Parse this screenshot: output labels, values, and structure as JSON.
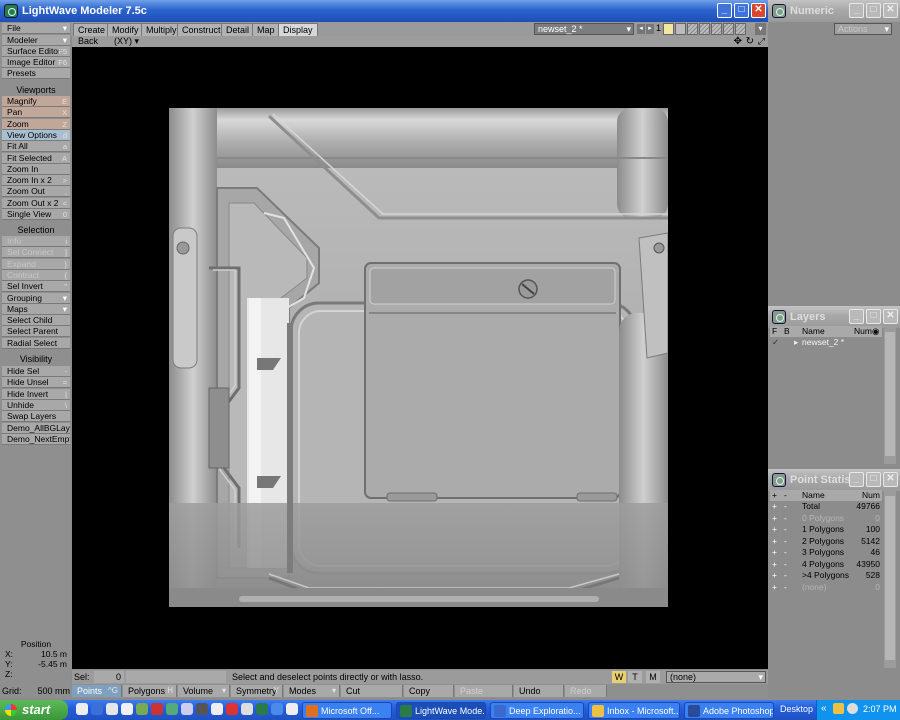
{
  "window": {
    "title": "LightWave Modeler 7.5c",
    "tabs": [
      "Create",
      "Modify",
      "Multiply",
      "Construct",
      "Detail",
      "Map",
      "Display"
    ],
    "active_tab": "Display",
    "object_select": "newset_2 *",
    "layer_number": "1"
  },
  "left_menu": {
    "file": "File",
    "modeler": "Modeler",
    "items_top": [
      {
        "label": "Surface Editor",
        "shortcut": "F5"
      },
      {
        "label": "Image Editor",
        "shortcut": "F6"
      },
      {
        "label": "Presets",
        "shortcut": ""
      }
    ]
  },
  "toolbar": {
    "viewports_header": "Viewports",
    "viewports": [
      {
        "label": "Magnify",
        "shortcut": "E"
      },
      {
        "label": "Pan",
        "shortcut": "X"
      },
      {
        "label": "Zoom",
        "shortcut": "Z"
      },
      {
        "label": "View Options",
        "shortcut": "d"
      },
      {
        "label": "Fit All",
        "shortcut": "a"
      },
      {
        "label": "Fit Selected",
        "shortcut": "A"
      },
      {
        "label": "Zoom In",
        "shortcut": "."
      },
      {
        "label": "Zoom In x 2",
        "shortcut": ">"
      },
      {
        "label": "Zoom Out",
        "shortcut": ","
      },
      {
        "label": "Zoom Out x 2",
        "shortcut": "<"
      },
      {
        "label": "Single View",
        "shortcut": "0"
      }
    ],
    "selection_header": "Selection",
    "selection": [
      {
        "label": "Info",
        "shortcut": "i"
      },
      {
        "label": "Sel Connect",
        "shortcut": "]"
      },
      {
        "label": "Expand",
        "shortcut": "}"
      },
      {
        "label": "Contract",
        "shortcut": "{"
      },
      {
        "label": "Sel Invert",
        "shortcut": "\""
      },
      {
        "label": "Grouping",
        "shortcut": ""
      },
      {
        "label": "Maps",
        "shortcut": ""
      },
      {
        "label": "Select Child",
        "shortcut": ""
      },
      {
        "label": "Select Parent",
        "shortcut": ""
      },
      {
        "label": "Radial Select",
        "shortcut": ""
      }
    ],
    "visibility_header": "Visibility",
    "visibility": [
      {
        "label": "Hide Sel",
        "shortcut": "-"
      },
      {
        "label": "Hide Unsel",
        "shortcut": "="
      },
      {
        "label": "Hide Invert",
        "shortcut": "|"
      },
      {
        "label": "Unhide",
        "shortcut": "\\"
      },
      {
        "label": "Swap Layers",
        "shortcut": ""
      },
      {
        "label": "Demo_AllBGLay",
        "shortcut": ""
      },
      {
        "label": "Demo_NextEmpt",
        "shortcut": ""
      }
    ]
  },
  "viewport": {
    "back_label": "Back",
    "view_label": "(XY)"
  },
  "position": {
    "header": "Position",
    "x_label": "X:",
    "x_value": "10.5 m",
    "y_label": "Y:",
    "y_value": "-5.45 m",
    "z_label": "Z:",
    "z_value": "",
    "grid_label": "Grid:",
    "grid_value": "500 mm"
  },
  "status": {
    "sel_label": "Sel:",
    "sel_value": "0",
    "message": "Select and deselect points directly or with lasso.",
    "w": "W",
    "t": "T",
    "m": "M",
    "surface": "(none)"
  },
  "bottom_bar": [
    {
      "label": "Points",
      "shortcut": "^G",
      "state": "on"
    },
    {
      "label": "Polygons",
      "shortcut": "H",
      "state": "normal"
    },
    {
      "label": "Volume",
      "shortcut": "",
      "state": "menu"
    },
    {
      "label": "Symmetry",
      "shortcut": "Y",
      "state": "normal"
    },
    {
      "label": "Modes",
      "shortcut": "",
      "state": "menu"
    },
    {
      "label": "Cut",
      "shortcut": "",
      "state": "normal"
    },
    {
      "label": "Copy",
      "shortcut": "",
      "state": "normal"
    },
    {
      "label": "Paste",
      "shortcut": "",
      "state": "dis"
    },
    {
      "label": "Undo",
      "shortcut": "",
      "state": "normal"
    },
    {
      "label": "Redo",
      "shortcut": "",
      "state": "dis"
    }
  ],
  "numeric": {
    "title": "Numeric",
    "actions": "Actions"
  },
  "layers": {
    "title": "Layers",
    "col_f": "F",
    "col_b": "B",
    "col_name": "Name",
    "col_num": "Num",
    "row": "newset_2 *"
  },
  "point_stats": {
    "title": "Point Statis...",
    "col_name": "Name",
    "col_num": "Num",
    "rows": [
      {
        "name": "Total",
        "num": "49766",
        "dim": false
      },
      {
        "name": "0 Polygons",
        "num": "0",
        "dim": true
      },
      {
        "name": "1 Polygons",
        "num": "100",
        "dim": false
      },
      {
        "name": "2 Polygons",
        "num": "5142",
        "dim": false
      },
      {
        "name": "3 Polygons",
        "num": "46",
        "dim": false
      },
      {
        "name": "4 Polygons",
        "num": "43950",
        "dim": false
      },
      {
        "name": ">4 Polygons",
        "num": "528",
        "dim": false
      },
      {
        "name": "(none)",
        "num": "0",
        "dim": true
      }
    ]
  },
  "taskbar": {
    "start": "start",
    "tasks": [
      {
        "label": "Microsoft Off...",
        "color": "#e07020",
        "active": false
      },
      {
        "label": "LightWave Mode...",
        "color": "#2a7a4a",
        "active": true
      },
      {
        "label": "Deep Exploratio...",
        "color": "#3a6ad0",
        "active": false
      },
      {
        "label": "Inbox - Microsoft...",
        "color": "#f0c040",
        "active": false
      },
      {
        "label": "Adobe Photoshop",
        "color": "#2a4a9a",
        "active": false
      }
    ],
    "desktop": "Desktop",
    "clock": "2:07 PM"
  }
}
